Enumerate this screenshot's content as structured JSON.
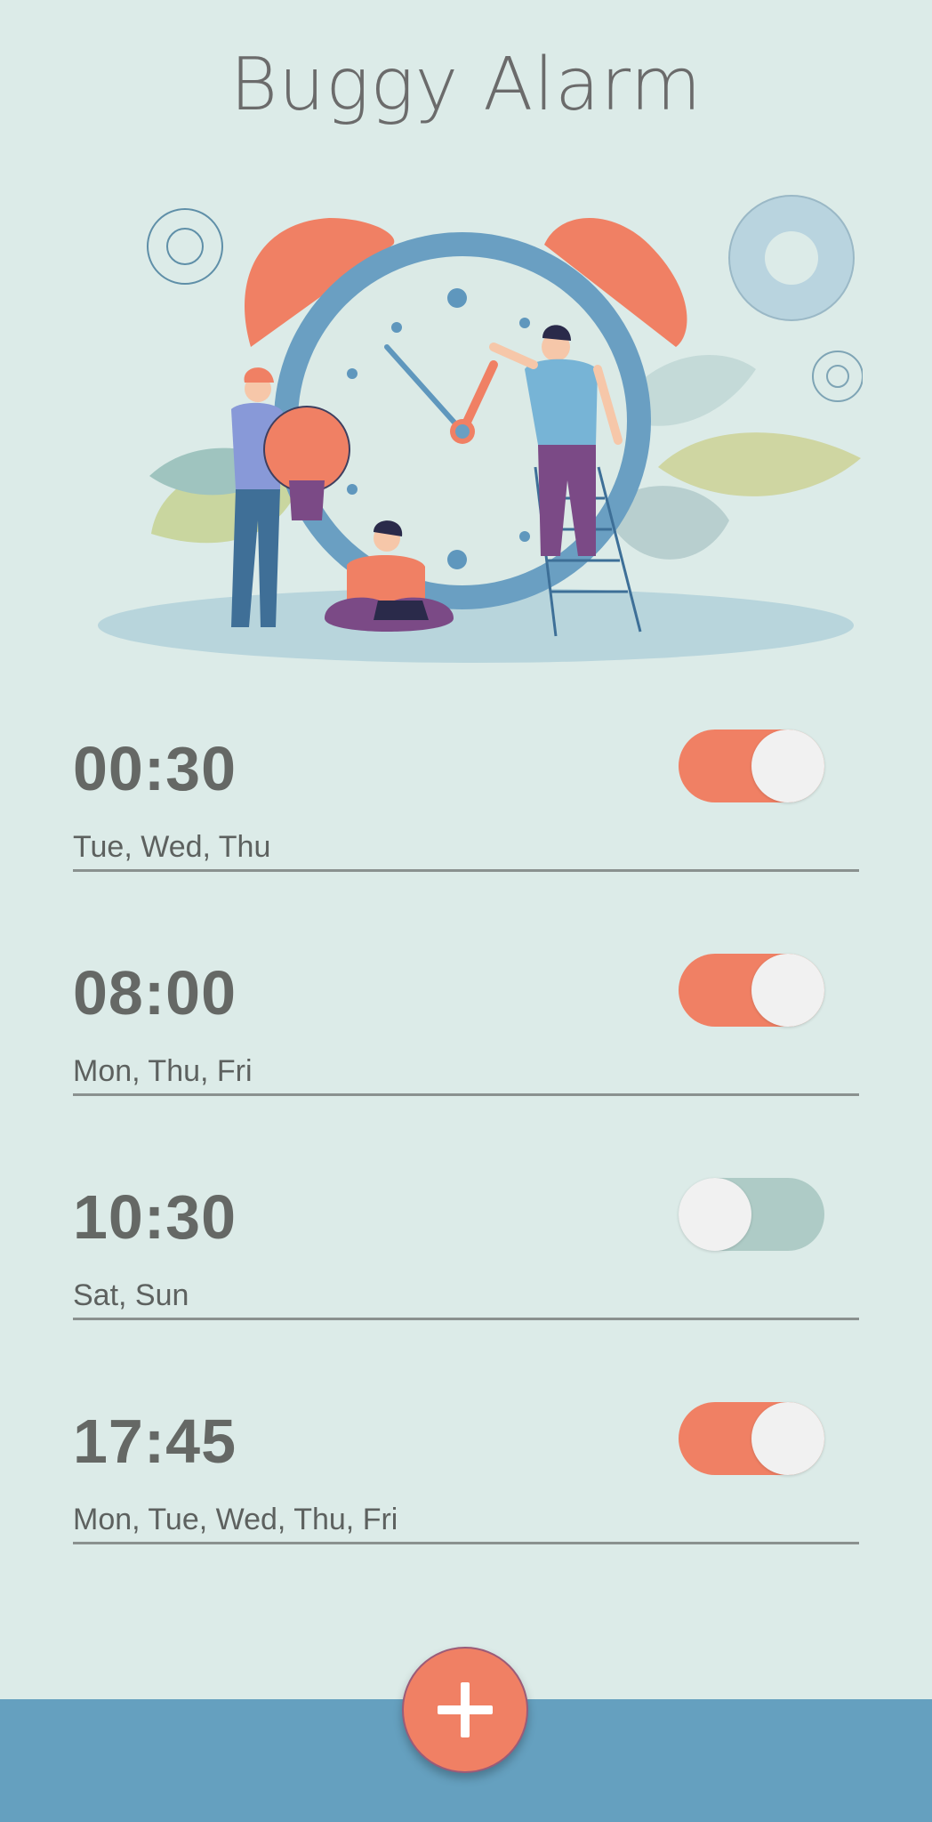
{
  "app": {
    "title": "Buggy Alarm"
  },
  "hero": {
    "illustration": "alarm-clock-people-illustration"
  },
  "alarms": [
    {
      "time": "00:30",
      "days": "Tue, Wed, Thu",
      "enabled": true
    },
    {
      "time": "08:00",
      "days": "Mon, Thu, Fri",
      "enabled": true
    },
    {
      "time": "10:30",
      "days": "Sat, Sun",
      "enabled": false
    },
    {
      "time": "17:45",
      "days": "Mon, Tue, Wed, Thu, Fri",
      "enabled": true
    }
  ],
  "fab": {
    "icon": "plus-icon"
  },
  "colors": {
    "background": "#dcebe8",
    "accent": "#f08064",
    "toggle_off": "#aecbc6",
    "bottom_bar": "#65a0bf",
    "text": "#656865"
  }
}
